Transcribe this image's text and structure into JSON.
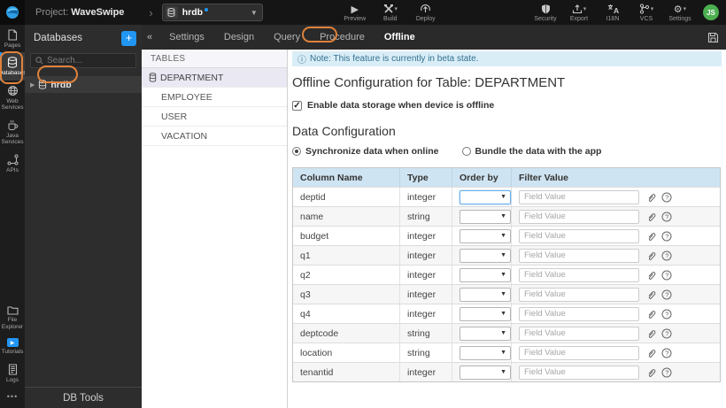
{
  "colors": {
    "annotation_orange": "#e0823c",
    "accent_blue": "#2196f3",
    "note_bg": "#d9edf7",
    "note_text": "#31708f",
    "table_header_bg": "#cfe4f2",
    "avatar_green": "#4caf50"
  },
  "topbar": {
    "project_label": "Project:",
    "project_name": "WaveSwipe",
    "db_selector": "hrdb",
    "actions": {
      "preview": "Preview",
      "build": "Build",
      "deploy": "Deploy",
      "security": "Security",
      "export": "Export",
      "i18n": "I18N",
      "vcs": "VCS",
      "settings": "Settings"
    },
    "avatar": "JS"
  },
  "sidebar": {
    "items": [
      {
        "label": "Pages",
        "active": false
      },
      {
        "label": "Databases",
        "active": true
      },
      {
        "label": "Web Services",
        "active": false
      },
      {
        "label": "Java Services",
        "active": false
      },
      {
        "label": "APIs",
        "active": false
      },
      {
        "label": "File Explorer",
        "active": false
      },
      {
        "label": "Tutorials",
        "active": false
      },
      {
        "label": "Logs",
        "active": false
      }
    ],
    "more": "•••"
  },
  "db_panel": {
    "title": "Databases",
    "add_label": "+",
    "search_placeholder": "Search...",
    "db_name": "hrdb",
    "footer": "DB Tools"
  },
  "tabs": {
    "items": [
      "Settings",
      "Design",
      "Query",
      "Procedure",
      "Offline"
    ],
    "active": "Offline",
    "collapse": "«"
  },
  "tables_panel": {
    "header": "TABLES",
    "tables": [
      "DEPARTMENT",
      "EMPLOYEE",
      "USER",
      "VACATION"
    ],
    "selected": "DEPARTMENT"
  },
  "main": {
    "note": "Note: This feature is currently in beta state.",
    "title": "Offline Configuration for Table: DEPARTMENT",
    "enable_label": "Enable data storage when device is offline",
    "enable_checked": true,
    "section_title": "Data Configuration",
    "radios": [
      {
        "label": "Synchronize data when online",
        "selected": true
      },
      {
        "label": "Bundle the data with the app",
        "selected": false
      }
    ],
    "config_table": {
      "headers": [
        "Column Name",
        "Type",
        "Order by",
        "Filter Value"
      ],
      "filter_placeholder": "Field Value",
      "order_by_value": "",
      "rows": [
        {
          "name": "deptid",
          "type": "integer"
        },
        {
          "name": "name",
          "type": "string"
        },
        {
          "name": "budget",
          "type": "integer"
        },
        {
          "name": "q1",
          "type": "integer"
        },
        {
          "name": "q2",
          "type": "integer"
        },
        {
          "name": "q3",
          "type": "integer"
        },
        {
          "name": "q4",
          "type": "integer"
        },
        {
          "name": "deptcode",
          "type": "string"
        },
        {
          "name": "location",
          "type": "string"
        },
        {
          "name": "tenantid",
          "type": "integer"
        }
      ]
    }
  }
}
